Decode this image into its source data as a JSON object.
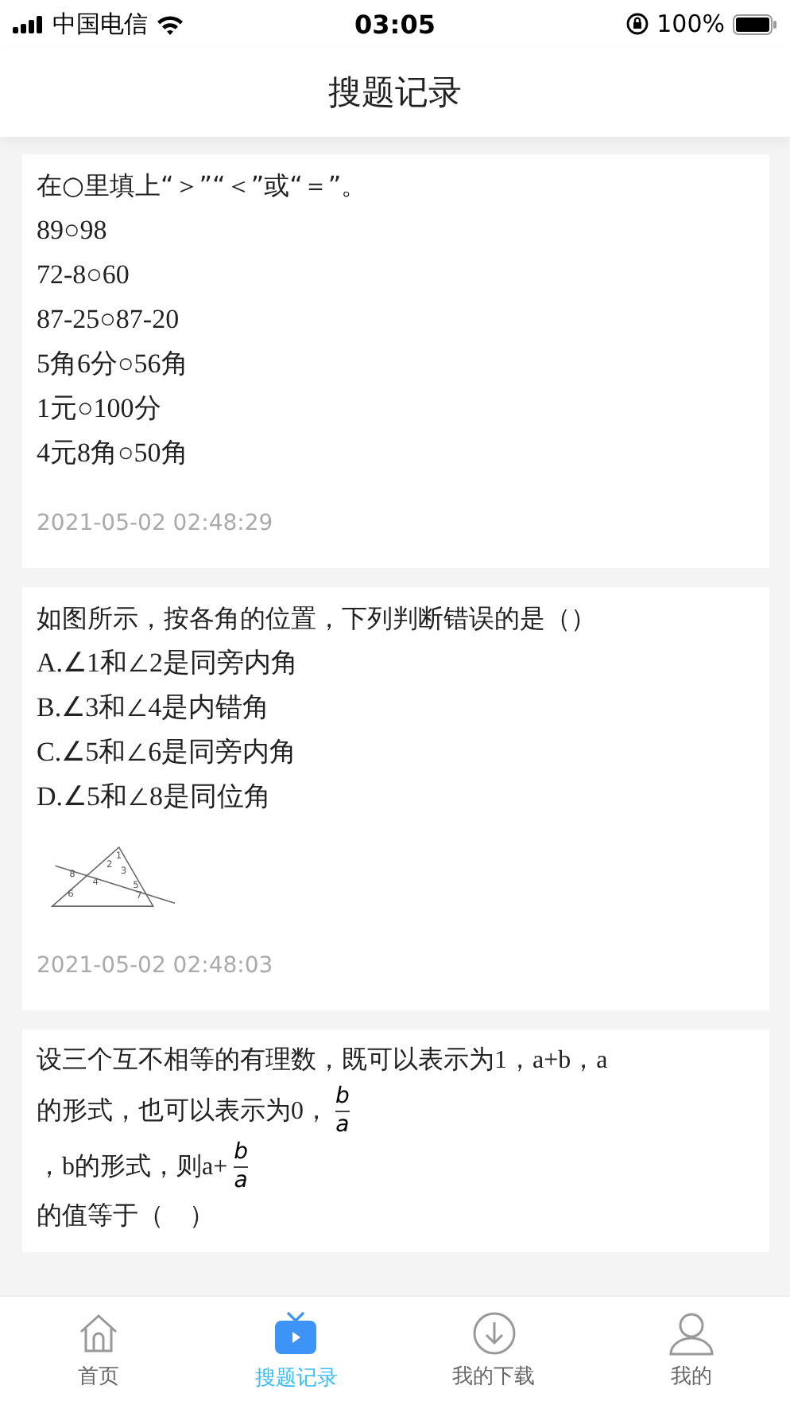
{
  "status_bar": {
    "carrier": "中国电信",
    "time": "03:05",
    "battery": "100%"
  },
  "header": {
    "title": "搜题记录"
  },
  "records": [
    {
      "kind": "lines",
      "lines": [
        "在○里填上“＞”“＜”或“＝”。",
        "89○98",
        "72-8○60",
        "87-25○87-20",
        "5角6分○56角",
        "1元○100分",
        "4元8角○50角"
      ],
      "time": "2021-05-02 02:48:29"
    },
    {
      "kind": "figure",
      "lines": [
        "如图所示，按各角的位置，下列判断错误的是（）",
        "A.∠1和∠2是同旁内角",
        "B.∠3和∠4是内错角",
        "C.∠5和∠6是同旁内角",
        "D.∠5和∠8是同位角"
      ],
      "figure_labels": [
        "1",
        "2",
        "3",
        "4",
        "5",
        "6",
        "7",
        "8"
      ],
      "time": "2021-05-02 02:48:03"
    },
    {
      "kind": "math",
      "paragraph_lines": [
        [
          {
            "kind": "text",
            "text": "设三个互不相等的有理数，既可以表示为1，a+b，a"
          }
        ],
        [
          {
            "kind": "text",
            "text": "的形式，也可以表示为0，"
          },
          {
            "kind": "fraction",
            "numerator": "b",
            "denominator": "a"
          }
        ],
        [
          {
            "kind": "text",
            "text": "，b的形式，则a+"
          },
          {
            "kind": "fraction",
            "numerator": "b",
            "denominator": "a"
          }
        ],
        [
          {
            "kind": "text",
            "text": "的值等于（　）"
          }
        ]
      ]
    }
  ],
  "tabs": [
    {
      "kind": "home",
      "label": "首页",
      "selected": false
    },
    {
      "kind": "record",
      "label": "搜题记录",
      "selected": true
    },
    {
      "kind": "download",
      "label": "我的下载",
      "selected": false
    },
    {
      "kind": "me",
      "label": "我的",
      "selected": false
    }
  ]
}
